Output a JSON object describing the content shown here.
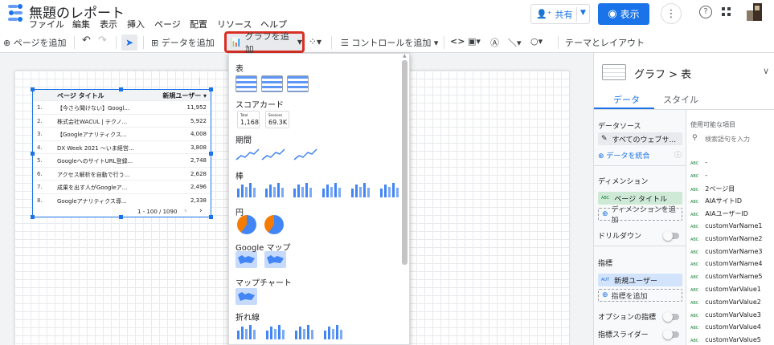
{
  "header": {
    "title": "無題のレポート",
    "menu": [
      "ファイル",
      "編集",
      "表示",
      "挿入",
      "ページ",
      "配置",
      "リソース",
      "ヘルプ"
    ],
    "share_label": "共有",
    "view_label": "表示"
  },
  "toolbar": {
    "add_page": "ページを追加",
    "add_data": "データを追加",
    "add_chart": "グラフを追加",
    "add_control": "コントロールを追加",
    "theme_layout": "テーマとレイアウト"
  },
  "table": {
    "col_title": "ページ タイトル",
    "col_metric": "新規ユーザー ▾",
    "rows": [
      {
        "n": "1.",
        "title": "【今さら聞けない】Googl...",
        "value": "11,952"
      },
      {
        "n": "2.",
        "title": "株式会社WACUL | テクノ...",
        "value": "5,922"
      },
      {
        "n": "3.",
        "title": "【Googleアナリティクス...",
        "value": "4,008"
      },
      {
        "n": "4.",
        "title": "DX Week 2021 ～いま経営...",
        "value": "3,808"
      },
      {
        "n": "5.",
        "title": "GoogleへのサイトURL登録...",
        "value": "2,748"
      },
      {
        "n": "6.",
        "title": "アクセス解析を自動で行う...",
        "value": "2,628"
      },
      {
        "n": "7.",
        "title": "成果を出す人がGoogleア...",
        "value": "2,496"
      },
      {
        "n": "8.",
        "title": "Googleアナリティクス導...",
        "value": "2,338"
      }
    ],
    "pagination": "1 - 100 / 1090"
  },
  "chart_menu": {
    "sections": [
      "表",
      "スコアカード",
      "期間",
      "棒",
      "円",
      "Google マップ",
      "マップチャート",
      "折れ線"
    ],
    "scorecard1_label": "Total",
    "scorecard1_value": "1,168",
    "scorecard2_label": "Sessions",
    "scorecard2_value": "69.3K"
  },
  "panel": {
    "breadcrumb": "グラフ > 表",
    "tab_data": "データ",
    "tab_style": "スタイル",
    "datasource_label": "データソース",
    "datasource_value": "すべてのウェブサ...",
    "blend_label": "データを統合",
    "dimension_label": "ディメンション",
    "dimension_value": "ページ タイトル",
    "add_dimension": "ディメンションを追加",
    "drilldown_label": "ドリルダウン",
    "metric_label": "指標",
    "metric_value": "新規ユーザー",
    "add_metric": "指標を追加",
    "optional_metric": "オプションの指標",
    "metric_slider": "指標スライダー",
    "available_fields": "使用可能な項目",
    "search_placeholder": "検索語句を入力",
    "field_type": "ABC",
    "metric_type": "AUT",
    "fields": [
      "-",
      "-",
      "2ページ目",
      "AIAサイトID",
      "AIAユーザーID",
      "customVarName1",
      "customVarName2",
      "customVarName3",
      "customVarName4",
      "customVarName5",
      "customVarValue1",
      "customVarValue2",
      "customVarValue3",
      "customVarValue4",
      "customVarValue5"
    ]
  },
  "colors": {
    "accent": "#1a73e8",
    "highlight": "#d93025",
    "dim_chip": "#ceead6",
    "metric_chip": "#d2e3fc"
  }
}
